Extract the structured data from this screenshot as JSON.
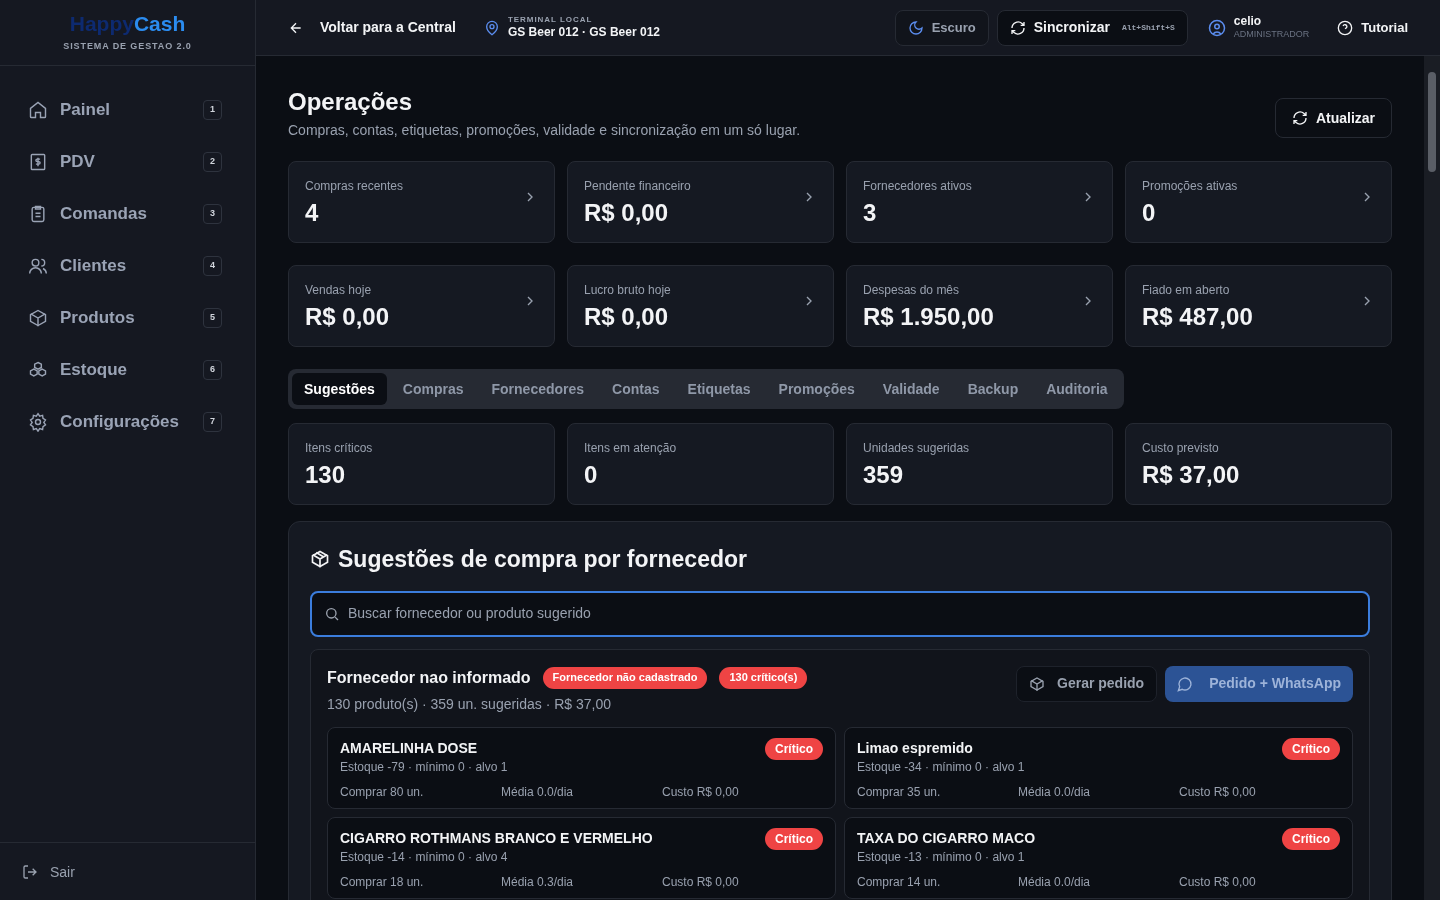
{
  "logo": {
    "part_1": "Happy",
    "part_2": "Cash",
    "subtitle": "SISTEMA DE GESTAO 2.0"
  },
  "sidebar": {
    "items": [
      {
        "label": "Painel",
        "shortcut": "1"
      },
      {
        "label": "PDV",
        "shortcut": "2"
      },
      {
        "label": "Comandas",
        "shortcut": "3"
      },
      {
        "label": "Clientes",
        "shortcut": "4"
      },
      {
        "label": "Produtos",
        "shortcut": "5"
      },
      {
        "label": "Estoque",
        "shortcut": "6"
      },
      {
        "label": "Configurações",
        "shortcut": "7"
      }
    ],
    "logout": "Sair"
  },
  "header": {
    "back": "Voltar para a Central",
    "terminal_label": "TERMINAL LOCAL",
    "terminal": "GS Beer 012 · GS Beer 012",
    "theme_button": "Escuro",
    "sync_button": "Sincronizar",
    "sync_shortcut": "Alt+Shift+S",
    "user": "celio",
    "role": "ADMINISTRADOR",
    "tutorial": "Tutorial"
  },
  "page": {
    "title": "Operações",
    "subtitle": "Compras, contas, etiquetas, promoções, validade e sincronização em um só lugar.",
    "refresh_button": "Atualizar"
  },
  "summary_cards": [
    {
      "label": "Compras recentes",
      "value": "4"
    },
    {
      "label": "Pendente financeiro",
      "value": "R$ 0,00"
    },
    {
      "label": "Fornecedores ativos",
      "value": "3"
    },
    {
      "label": "Promoções ativas",
      "value": "0"
    },
    {
      "label": "Vendas hoje",
      "value": "R$ 0,00"
    },
    {
      "label": "Lucro bruto hoje",
      "value": "R$ 0,00"
    },
    {
      "label": "Despesas do mês",
      "value": "R$ 1.950,00"
    },
    {
      "label": "Fiado em aberto",
      "value": "R$ 487,00"
    }
  ],
  "tabs": [
    {
      "label": "Sugestões",
      "selected": true
    },
    {
      "label": "Compras",
      "selected": false
    },
    {
      "label": "Fornecedores",
      "selected": false
    },
    {
      "label": "Contas",
      "selected": false
    },
    {
      "label": "Etiquetas",
      "selected": false
    },
    {
      "label": "Promoções",
      "selected": false
    },
    {
      "label": "Validade",
      "selected": false
    },
    {
      "label": "Backup",
      "selected": false
    },
    {
      "label": "Auditoria",
      "selected": false
    }
  ],
  "suggestion_stats": [
    {
      "label": "Itens críticos",
      "value": "130"
    },
    {
      "label": "Itens em atenção",
      "value": "0"
    },
    {
      "label": "Unidades sugeridas",
      "value": "359"
    },
    {
      "label": "Custo previsto",
      "value": "R$ 37,00"
    }
  ],
  "suggestions_panel": {
    "title": "Sugestões de compra por fornecedor",
    "search": {
      "placeholder": "Buscar fornecedor ou produto sugerido"
    },
    "groups": [
      {
        "supplier": "Fornecedor nao informado",
        "tags": [
          "Fornecedor não cadastrado",
          "130 crítico(s)"
        ],
        "summary": "130 produto(s) · 359 un. sugeridas · R$ 37,00",
        "order_button": "Gerar pedido",
        "whatsapp_button": "Pedido + WhatsApp",
        "products": [
          {
            "name": "AMARELINHA DOSE",
            "stock": "Estoque -79 · mínimo 0 · alvo 1",
            "status": "Crítico",
            "buy": "Comprar 80 un.",
            "average": "Média 0.0/dia",
            "cost": "Custo R$ 0,00"
          },
          {
            "name": "Limao espremido",
            "stock": "Estoque -34 · mínimo 0 · alvo 1",
            "status": "Crítico",
            "buy": "Comprar 35 un.",
            "average": "Média 0.0/dia",
            "cost": "Custo R$ 0,00"
          },
          {
            "name": "CIGARRO ROTHMANS BRANCO E VERMELHO",
            "stock": "Estoque -14 · mínimo 0 · alvo 4",
            "status": "Crítico",
            "buy": "Comprar 18 un.",
            "average": "Média 0.3/dia",
            "cost": "Custo R$ 0,00"
          },
          {
            "name": "TAXA DO CIGARRO MACO",
            "stock": "Estoque -13 · mínimo 0 · alvo 1",
            "status": "Crítico",
            "buy": "Comprar 14 un.",
            "average": "Média 0.0/dia",
            "cost": "Custo R$ 0,00"
          }
        ]
      }
    ]
  }
}
